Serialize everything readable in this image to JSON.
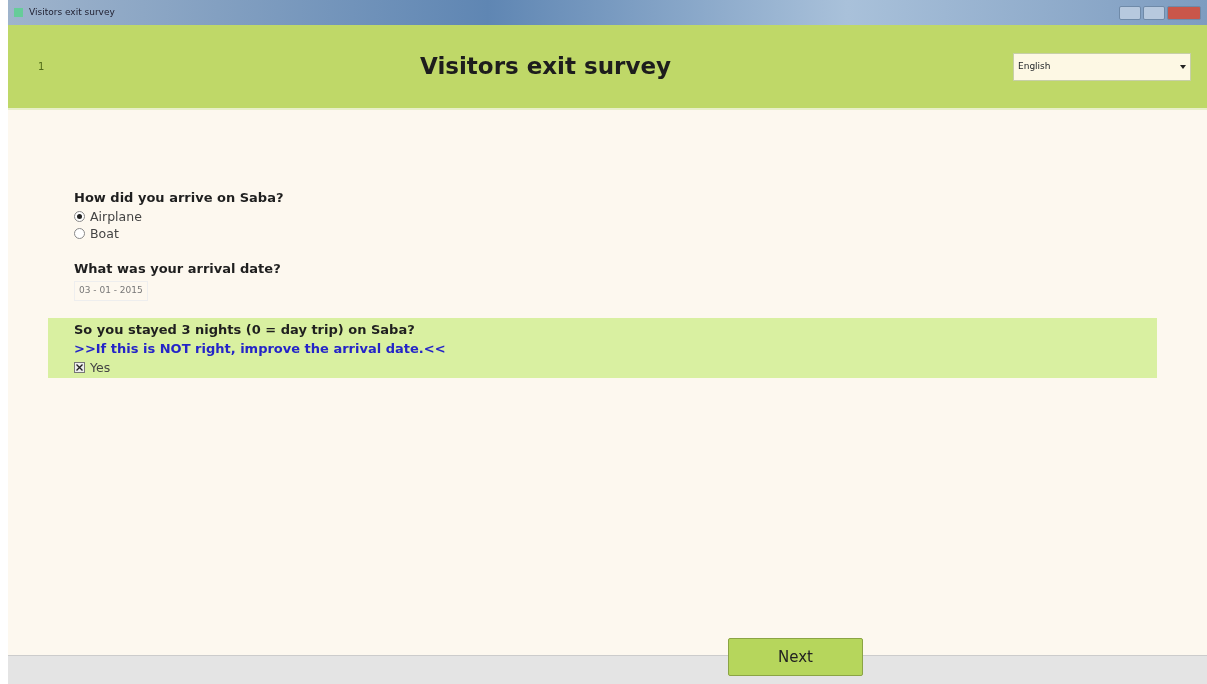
{
  "window": {
    "title": "Visitors exit survey"
  },
  "header": {
    "page_number": "1",
    "title": "Visitors exit survey",
    "language": "English"
  },
  "questions": [
    {
      "kind": "radio",
      "label": "How did you arrive on Saba?",
      "options": [
        {
          "label": "Airplane",
          "selected": true
        },
        {
          "label": "Boat",
          "selected": false
        }
      ]
    },
    {
      "kind": "date",
      "label": "What was your arrival date?",
      "value": "03 - 01 - 2015"
    },
    {
      "kind": "confirm",
      "label": "So you stayed 3 nights (0 = day trip) on Saba?",
      "hint": ">>If this is NOT right, improve the arrival date.<<",
      "checkbox": {
        "label": "Yes",
        "checked": true
      }
    }
  ],
  "footer": {
    "next_button": "Next"
  }
}
